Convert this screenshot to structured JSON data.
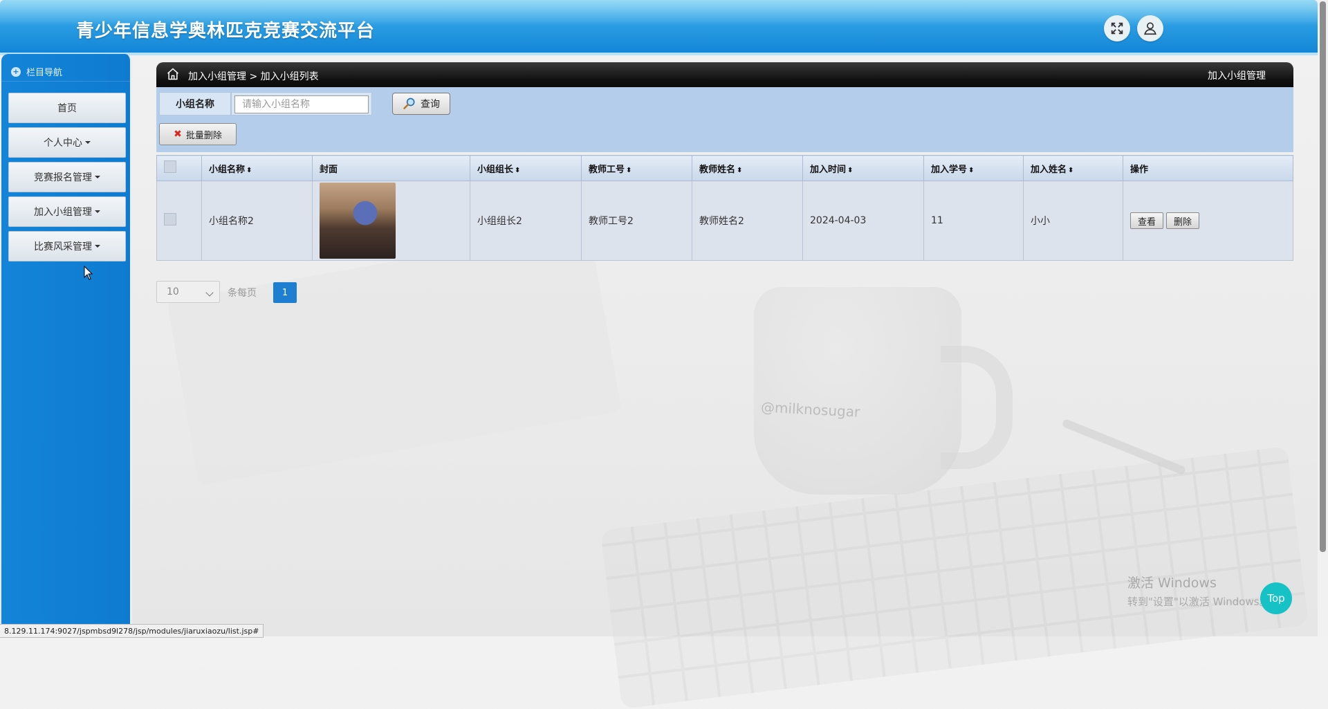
{
  "header": {
    "title": "青少年信息学奥林匹克竞赛交流平台"
  },
  "sidebar": {
    "nav_title": "栏目导航",
    "items": [
      {
        "label": "首页",
        "has_caret": false
      },
      {
        "label": "个人中心",
        "has_caret": true
      },
      {
        "label": "竞赛报名管理",
        "has_caret": true
      },
      {
        "label": "加入小组管理",
        "has_caret": true
      },
      {
        "label": "比赛风采管理",
        "has_caret": true
      }
    ]
  },
  "breadcrumb": {
    "path": "加入小组管理  >  加入小组列表",
    "right_title": "加入小组管理"
  },
  "search": {
    "label": "小组名称",
    "placeholder": "请输入小组名称",
    "query_button": "查询",
    "batch_delete_button": "批量删除"
  },
  "table": {
    "columns": [
      "小组名称",
      "封面",
      "小组组长",
      "教师工号",
      "教师姓名",
      "加入时间",
      "加入学号",
      "加入姓名",
      "操作"
    ],
    "rows": [
      {
        "group_name": "小组名称2",
        "leader": "小组组长2",
        "teacher_no": "教师工号2",
        "teacher_name": "教师姓名2",
        "join_time": "2024-04-03",
        "student_no": "11",
        "student_name": "小小",
        "view_label": "查看",
        "delete_label": "删除"
      }
    ]
  },
  "pager": {
    "page_size": "10",
    "per_page_text": "条每页",
    "current_page": "1"
  },
  "watermark": {
    "line1": "激活 Windows",
    "line2": "转到\"设置\"以激活 Windows。"
  },
  "top_button": "Top",
  "status_url": "8.129.11.174:9027/jspmbsd9l278/jsp/modules/jiaruxiaozu/list.jsp#",
  "background_mug_text": "@milknosugar",
  "colors": {
    "header_blue": "#1183d6",
    "sidebar_blue": "#1384d8",
    "search_panel": "#b3cdeb",
    "page_button": "#1e7fd2",
    "top_button": "#17c2c6"
  }
}
